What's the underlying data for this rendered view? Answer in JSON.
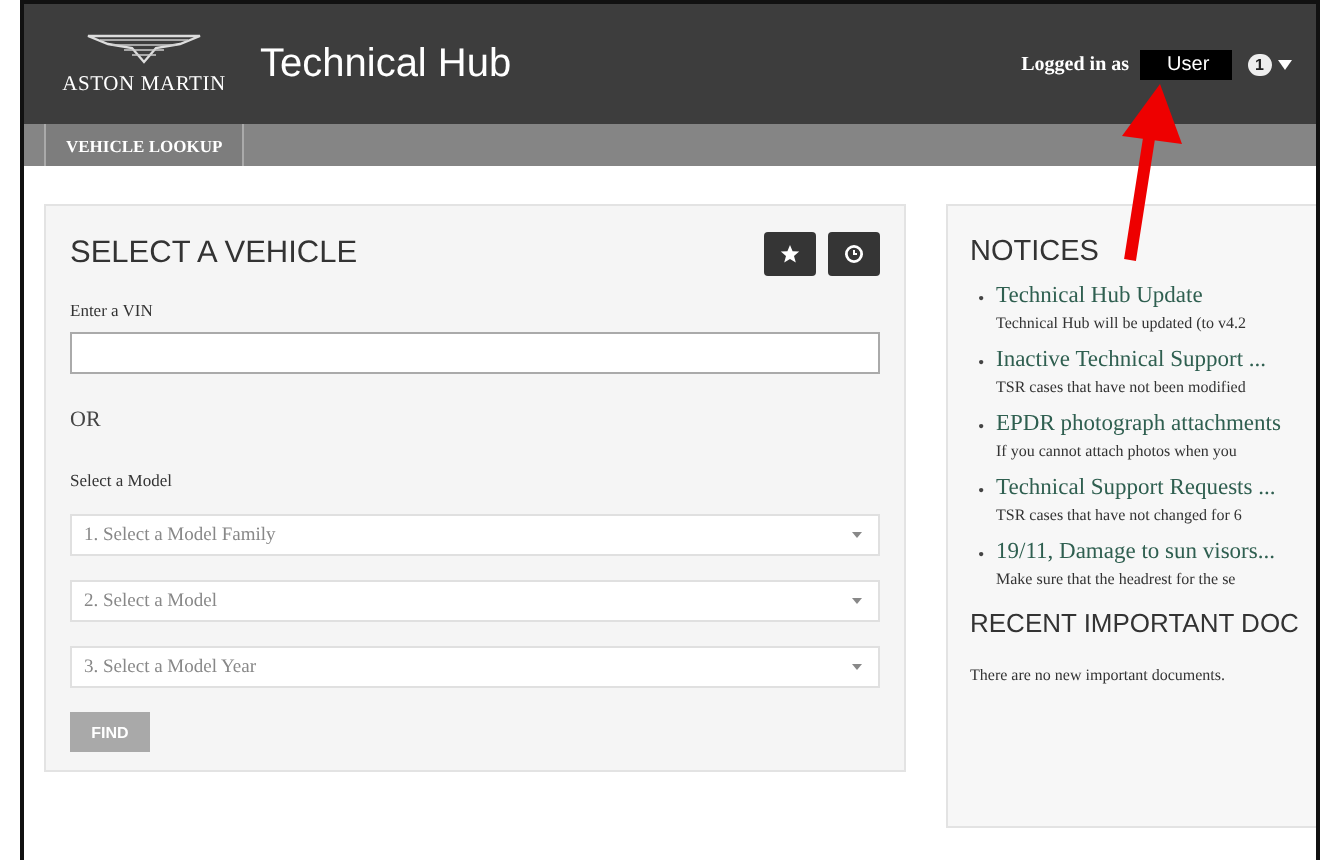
{
  "header": {
    "brand": "ASTON MARTIN",
    "title": "Technical Hub",
    "login_label": "Logged in as",
    "user": "User",
    "badge": "1"
  },
  "nav": {
    "tabs": [
      {
        "label": "VEHICLE LOOKUP",
        "selected": true
      }
    ]
  },
  "vehicle_panel": {
    "title": "SELECT A VEHICLE",
    "vin_label": "Enter a VIN",
    "or": "OR",
    "model_label": "Select a Model",
    "selects": [
      {
        "placeholder": "1. Select a Model Family"
      },
      {
        "placeholder": "2. Select a Model"
      },
      {
        "placeholder": "3. Select a Model Year"
      }
    ],
    "find_button": {
      "label": "FIND",
      "disabled": true
    }
  },
  "notices": {
    "title": "NOTICES",
    "items": [
      {
        "bullet": "•",
        "title": "Technical Hub Update",
        "text": "Technical Hub will be updated (to v4.2"
      },
      {
        "bullet": "•",
        "title": "Inactive Technical Support ...",
        "text": "TSR cases that have not been modified"
      },
      {
        "bullet": "•",
        "title": "EPDR photograph attachments",
        "text": "If you cannot attach photos when you"
      },
      {
        "bullet": "•",
        "title": "Technical Support Requests ...",
        "text": "TSR cases that have not changed for 6"
      },
      {
        "bullet": "•",
        "title": "19/11, Damage to sun visors...",
        "text": "Make sure that the headrest for the se"
      }
    ],
    "documents_title": "RECENT IMPORTANT DOC",
    "documents_text": "There are no new important documents."
  },
  "annotation": {
    "kind": "arrow"
  }
}
